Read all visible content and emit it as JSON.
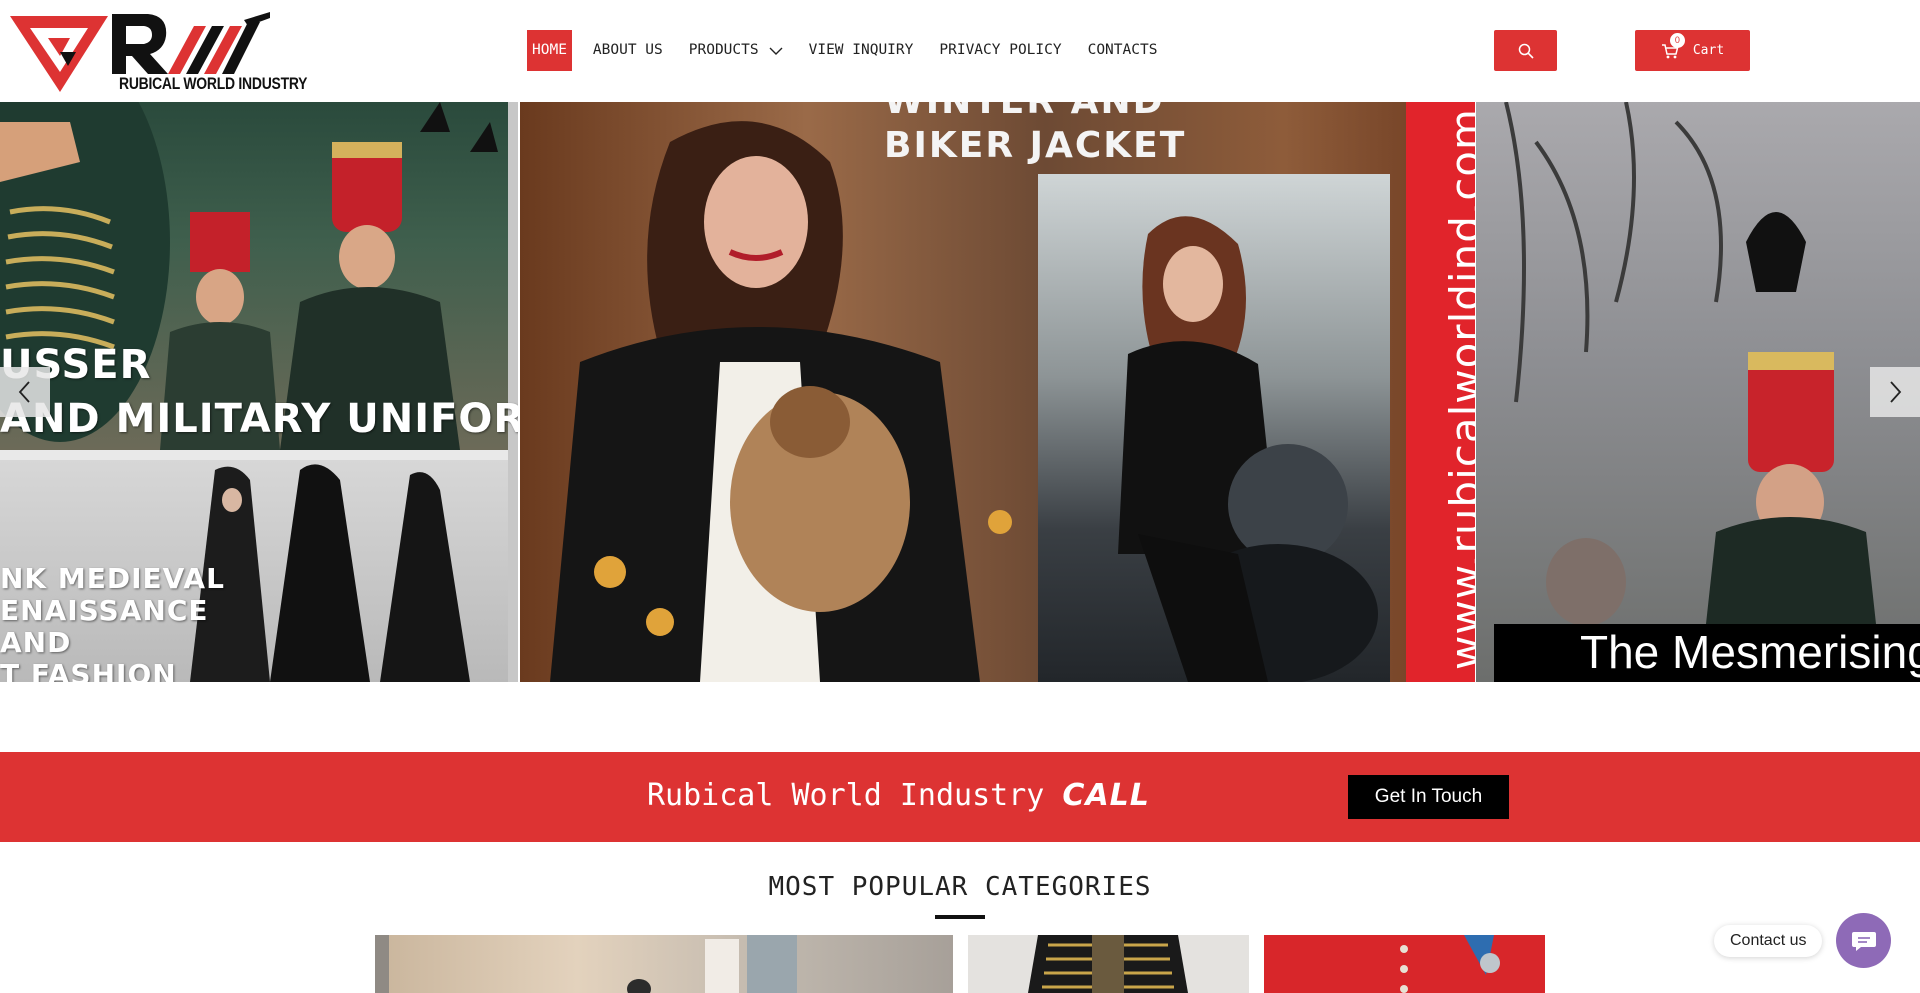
{
  "brand": {
    "name": "RUBICAL WORLD INDUSTRY",
    "logo_icon": "rwi-logo-icon",
    "accent_color": "#dd3333"
  },
  "nav": {
    "items": [
      {
        "label": "HOME",
        "active": true
      },
      {
        "label": "ABOUT US",
        "active": false
      },
      {
        "label": "PRODUCTS",
        "active": false,
        "has_dropdown": true
      },
      {
        "label": "VIEW INQUIRY",
        "active": false
      },
      {
        "label": "PRIVACY POLICY",
        "active": false
      },
      {
        "label": "CONTACTS",
        "active": false
      }
    ]
  },
  "header": {
    "search_icon": "search-icon",
    "cart": {
      "label": "Cart",
      "count": "0",
      "icon": "cart-icon"
    }
  },
  "slider": {
    "left_slide": {
      "caption_top_line1": "USSER",
      "caption_top_line2": "AND MILITARY UNIFORMS",
      "caption_bottom_line1": "NK MEDIEVAL",
      "caption_bottom_line2": "ENAISSANCE",
      "caption_bottom_line3": "AND",
      "caption_bottom_line4": "T FASHION"
    },
    "mid_slide": {
      "title": "WINTER AND\nBIKER JACKET",
      "url_text": "www.rubicalworldind.com"
    },
    "right_slide": {
      "caption": "The Mesmerising"
    },
    "prev_icon": "chevron-left-icon",
    "next_icon": "chevron-right-icon"
  },
  "call_band": {
    "text": "Rubical World Industry",
    "call_word": "CALL",
    "button_label": "Get In Touch"
  },
  "categories": {
    "heading": "MOST POPULAR CATEGORIES"
  },
  "contact_widget": {
    "label": "Contact us",
    "icon": "chat-icon",
    "color": "#8e6ab7"
  }
}
